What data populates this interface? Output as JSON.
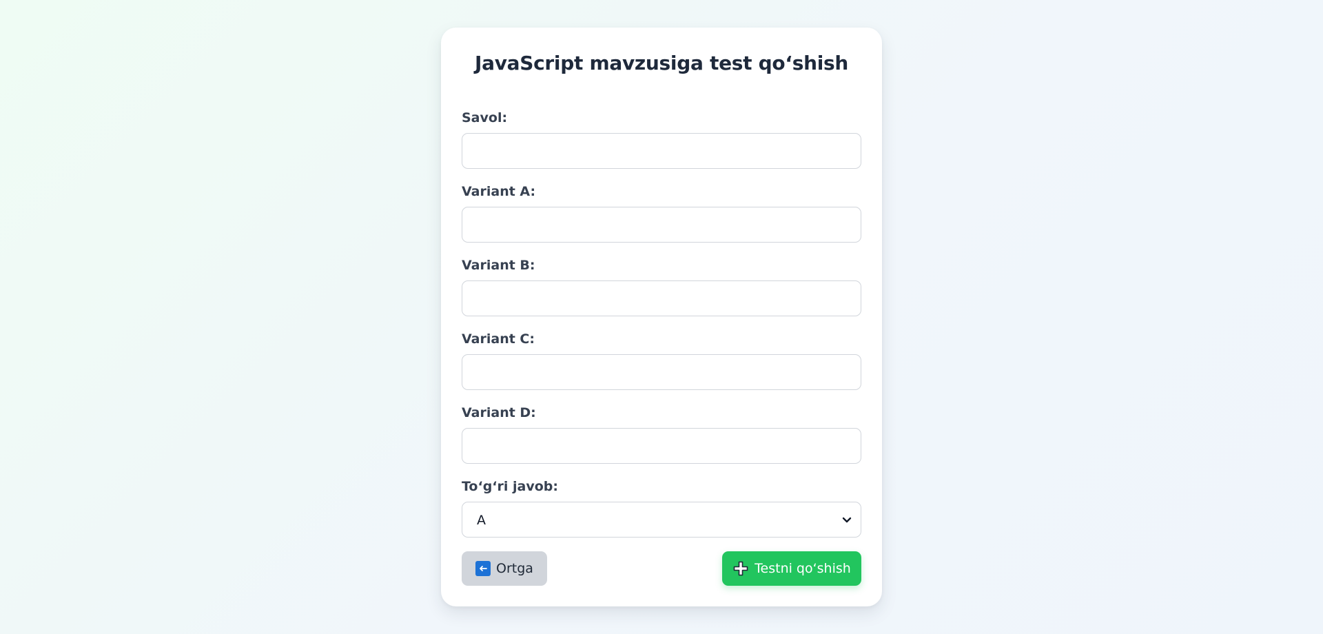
{
  "page": {
    "title": "JavaScript mavzusiga test qo‘shish"
  },
  "form": {
    "question": {
      "label": "Savol:",
      "value": "",
      "placeholder": ""
    },
    "option_a": {
      "label": "Variant A:",
      "value": "",
      "placeholder": ""
    },
    "option_b": {
      "label": "Variant B:",
      "value": "",
      "placeholder": ""
    },
    "option_c": {
      "label": "Variant C:",
      "value": "",
      "placeholder": ""
    },
    "option_d": {
      "label": "Variant D:",
      "value": "",
      "placeholder": ""
    },
    "correct_answer": {
      "label": "To‘g‘ri javob:",
      "selected": "A"
    }
  },
  "buttons": {
    "back_label": "Ortga",
    "back_icon": "left-arrow-icon",
    "submit_label": "Testni qo‘shish",
    "submit_icon": "plus-icon"
  },
  "colors": {
    "submit_bg": "#22c55e",
    "back_bg": "#d1d5db",
    "back_icon_bg": "#1d72d6",
    "title_text": "#1e293b",
    "label_text": "#374151"
  }
}
